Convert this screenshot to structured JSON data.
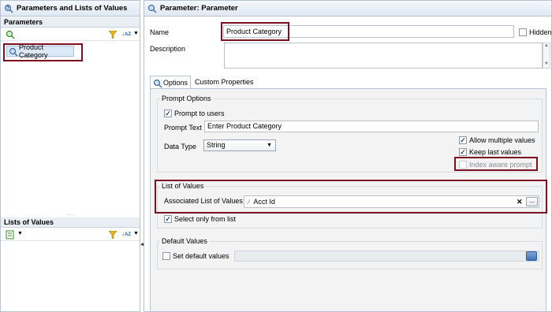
{
  "left_panel": {
    "title": "Parameters and Lists of Values",
    "parameters_header": "Parameters",
    "parameter_items": [
      "Product Category"
    ],
    "lov_header": "Lists of Values"
  },
  "right_panel": {
    "title": "Parameter: Parameter",
    "name_label": "Name",
    "name_value": "Product Category",
    "hidden_label": "Hidden",
    "description_label": "Description",
    "description_value": "",
    "tabs": [
      "Options",
      "Custom Properties"
    ],
    "prompt_options": {
      "title": "Prompt Options",
      "prompt_to_users": "Prompt to users",
      "prompt_text_label": "Prompt Text",
      "prompt_text_value": "Enter Product Category",
      "data_type_label": "Data Type",
      "data_type_value": "String",
      "allow_multiple": "Allow multiple values",
      "keep_last": "Keep last values",
      "index_aware": "Index aware prompt"
    },
    "list_of_values": {
      "title": "List of Values",
      "associated_label": "Associated List of Values",
      "associated_value": "Acct Id",
      "clear_symbol": "✕",
      "browse_label": "...",
      "select_only": "Select only from list"
    },
    "default_values": {
      "title": "Default Values",
      "set_default": "Set default values",
      "value": ""
    }
  },
  "colors": {
    "highlight": "#7b1020",
    "panel_border": "#b7c3d3"
  }
}
